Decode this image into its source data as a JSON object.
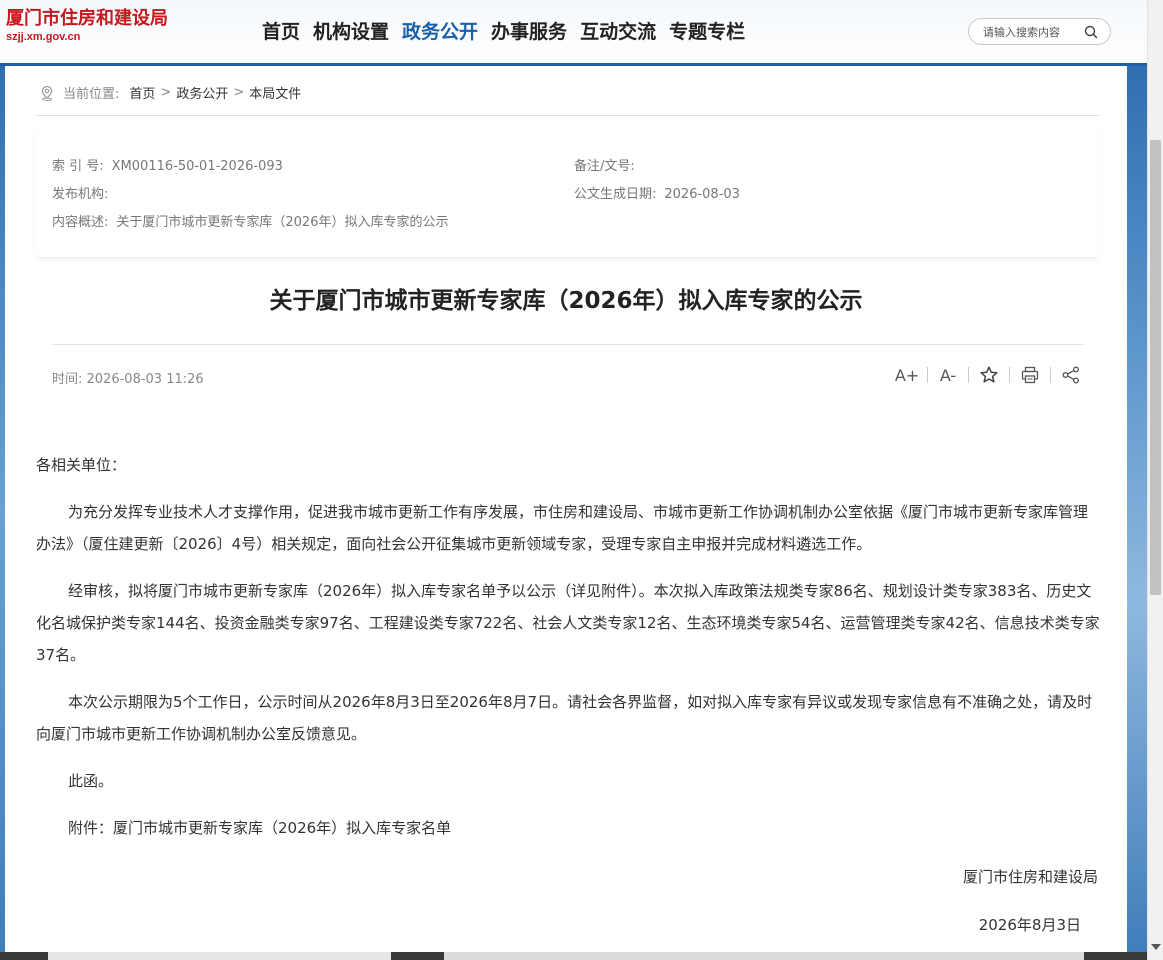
{
  "header": {
    "logo_title": "厦门市住房和建设局",
    "logo_domain": "szjj.xm.gov.cn",
    "nav": [
      {
        "label": "首页",
        "active": false
      },
      {
        "label": "机构设置",
        "active": false
      },
      {
        "label": "政务公开",
        "active": true
      },
      {
        "label": "办事服务",
        "active": false
      },
      {
        "label": "互动交流",
        "active": false
      },
      {
        "label": "专题专栏",
        "active": false
      }
    ],
    "search_placeholder": "请输入搜索内容",
    "accent_color": "#1b5fa8",
    "logo_color": "#c8161d"
  },
  "breadcrumb": {
    "label": "当前位置:",
    "items": [
      "首页",
      "政务公开",
      "本局文件"
    ],
    "separator": ">"
  },
  "meta": {
    "index_label": "索 引 号:",
    "index_value": "XM00116-50-01-2026-093",
    "note_label": "备注/文号:",
    "note_value": "",
    "publisher_label": "发布机构:",
    "publisher_value": "",
    "date_label": "公文生成日期:",
    "date_value": "2026-08-03",
    "summary_label": "内容概述:",
    "summary_value": "关于厦门市城市更新专家库（2026年）拟入库专家的公示"
  },
  "article": {
    "title": "关于厦门市城市更新专家库（2026年）拟入库专家的公示",
    "time_label": "时间:",
    "time_value": "2026-08-03 11:26",
    "tools": {
      "font_larger": "A+",
      "font_smaller": "A-"
    },
    "greeting": "各相关单位：",
    "paragraphs": [
      "为充分发挥专业技术人才支撑作用，促进我市城市更新工作有序发展，市住房和建设局、市城市更新工作协调机制办公室依据《厦门市城市更新专家库管理办法》（厦住建更新〔2026〕4号）相关规定，面向社会公开征集城市更新领域专家，受理专家自主申报并完成材料遴选工作。",
      "经审核，拟将厦门市城市更新专家库（2026年）拟入库专家名单予以公示（详见附件）。本次拟入库政策法规类专家86名、规划设计类专家383名、历史文化名城保护类专家144名、投资金融类专家97名、工程建设类专家722名、社会人文类专家12名、生态环境类专家54名、运营管理类专家42名、信息技术类专家37名。",
      "本次公示期限为5个工作日，公示时间从2026年8月3日至2026年8月7日。请社会各界监督，如对拟入库专家有异议或发现专家信息有不准确之处，请及时向厦门市城市更新工作协调机制办公室反馈意见。",
      "此函。",
      "附件：厦门市城市更新专家库（2026年）拟入库专家名单"
    ],
    "signature": "厦门市住房和建设局",
    "sign_date": "2026年8月3日"
  }
}
